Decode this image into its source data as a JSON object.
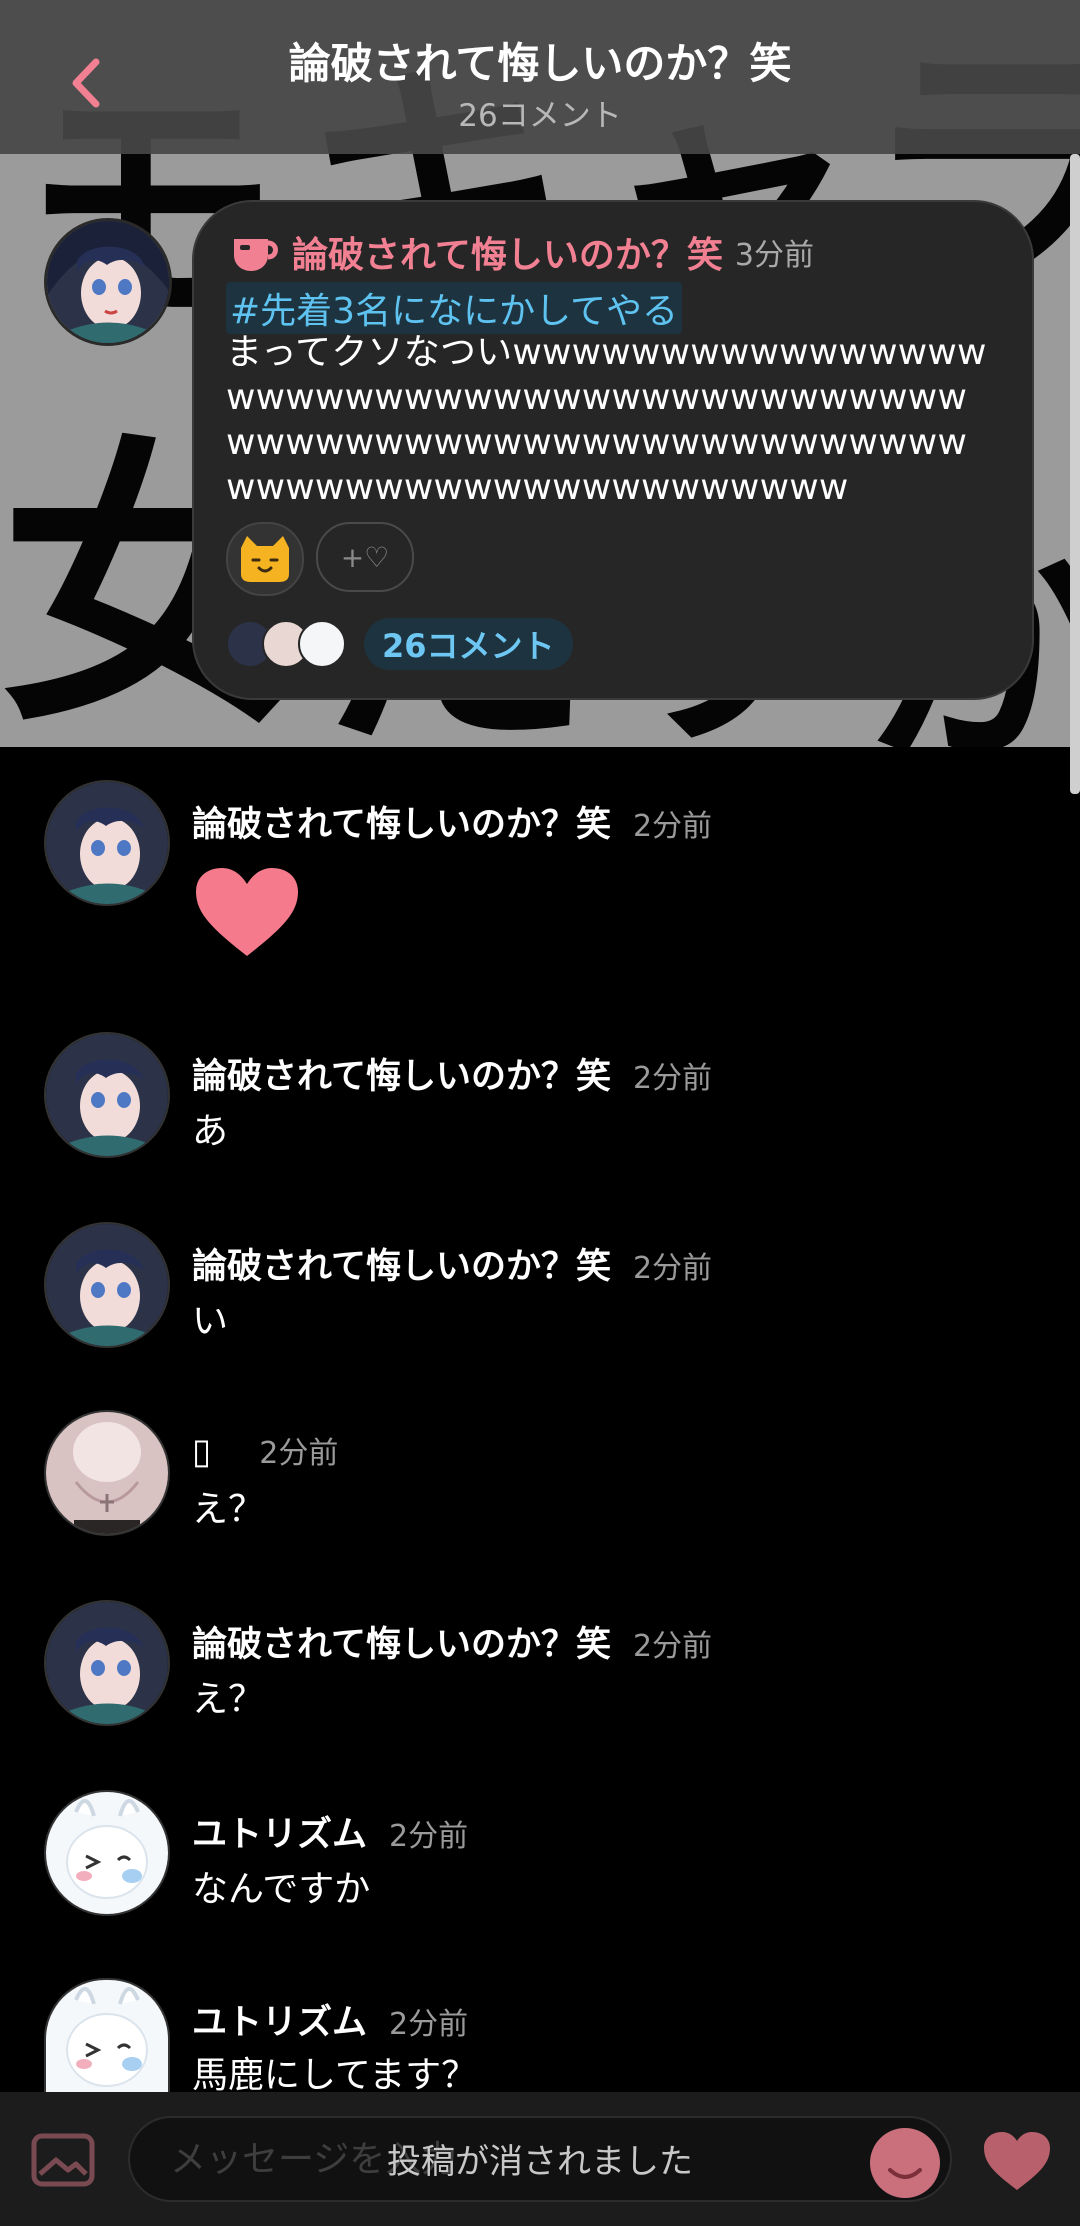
{
  "header": {
    "title": "論破されて悔しいのか？笑",
    "subtitle": "26コメント"
  },
  "hero": {
    "glyphs": [
      "モ",
      "キ",
      "ャ",
      "ラ",
      "女",
      "だ",
      "す",
      "か"
    ]
  },
  "post": {
    "author": "論破されて悔しいのか？笑",
    "time": "3分前",
    "tag": "#先着3名になにかしてやる",
    "body": "まってクソなついwwwwwwwwwwwwwwwwwwwwwwwwwwwwwwwwwwwwwwwwwwwwwwwwwwwwwwwwwwwwwwwwwwwwwwwwwwwwwwwwwwwwwww",
    "reaction_add": "+♡",
    "comment_count_label": "26コメント"
  },
  "comments": [
    {
      "name": "論破されて悔しいのか？笑",
      "time": "2分前",
      "text": "",
      "avatar": "girl-blue-avatar"
    },
    {
      "name": "論破されて悔しいのか？笑",
      "time": "2分前",
      "text": "あ",
      "avatar": "girl-blue-avatar"
    },
    {
      "name": "論破されて悔しいのか？笑",
      "time": "2分前",
      "text": "い",
      "avatar": "girl-blue-avatar"
    },
    {
      "name": "▯",
      "time": "2分前",
      "text": "え？",
      "avatar": "pink-photo-avatar"
    },
    {
      "name": "論破されて悔しいのか？笑",
      "time": "2分前",
      "text": "え？",
      "avatar": "girl-blue-avatar"
    },
    {
      "name": "ユトリズム",
      "time": "2分前",
      "text": "なんですか",
      "avatar": "white-rabbit-avatar"
    },
    {
      "name": "ユトリズム",
      "time": "2分前",
      "text": "馬鹿にしてます？",
      "avatar": "white-rabbit-avatar"
    }
  ],
  "composer": {
    "placeholder": "メッセージを入力",
    "deleted_notice": "投稿が消されました"
  },
  "colors": {
    "accent_pink": "#f28093",
    "link_blue": "#5ec3f0",
    "heart": "#f47a8c"
  }
}
